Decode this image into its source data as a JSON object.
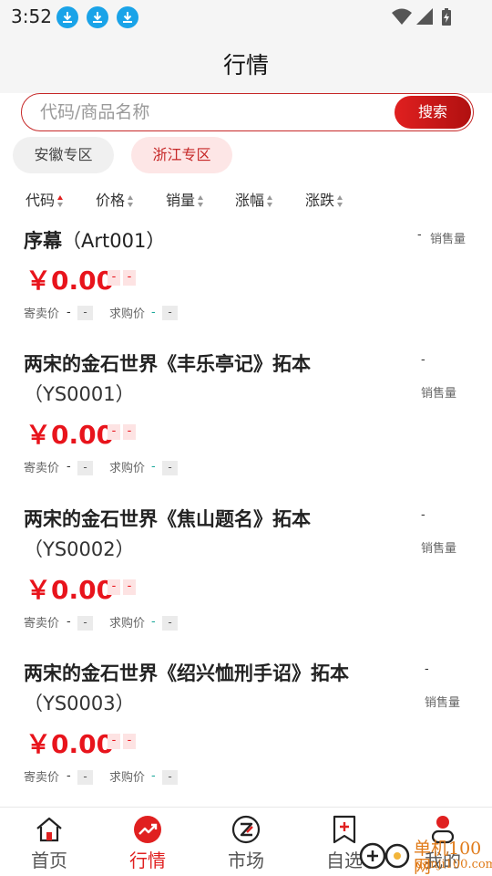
{
  "status_bar": {
    "time": "3:52"
  },
  "header": {
    "title": "行情"
  },
  "search": {
    "placeholder": "代码/商品名称",
    "button_label": "搜索"
  },
  "zones": [
    "安徽专区",
    "浙江专区"
  ],
  "zone_selected": "浙江专区",
  "sort_columns": [
    "代码",
    "价格",
    "销量",
    "涨幅",
    "涨跌"
  ],
  "items": [
    {
      "name": "序幕",
      "code": "（Art001）",
      "price": "￥0.00",
      "change": "-",
      "change_pct": "-",
      "sell_label": "寄卖价",
      "sell_value": "-",
      "sell_box": "-",
      "buy_label": "求购价",
      "buy_value": "-",
      "buy_box": "-",
      "volume": "-",
      "volume_label": "销售量"
    },
    {
      "name": "两宋的金石世界《丰乐亭记》拓本",
      "code": "（YS0001）",
      "price": "￥0.00",
      "change": "-",
      "change_pct": "-",
      "sell_label": "寄卖价",
      "sell_value": "-",
      "sell_box": "-",
      "buy_label": "求购价",
      "buy_value": "-",
      "buy_box": "-",
      "volume": "-",
      "volume_label": "销售量"
    },
    {
      "name": "两宋的金石世界《焦山题名》拓本",
      "code": "（YS0002）",
      "price": "￥0.00",
      "change": "-",
      "change_pct": "-",
      "sell_label": "寄卖价",
      "sell_value": "-",
      "sell_box": "-",
      "buy_label": "求购价",
      "buy_value": "-",
      "buy_box": "-",
      "volume": "-",
      "volume_label": "销售量"
    },
    {
      "name": "两宋的金石世界《绍兴恤刑手诏》拓本",
      "code": "（YS0003）",
      "price": "￥0.00",
      "change": "-",
      "change_pct": "-",
      "sell_label": "寄卖价",
      "sell_value": "-",
      "sell_box": "-",
      "buy_label": "求购价",
      "buy_value": "-",
      "buy_box": "-",
      "volume": "-",
      "volume_label": "销售量"
    }
  ],
  "bottom_nav": [
    {
      "label": "首页",
      "icon": "home-icon"
    },
    {
      "label": "行情",
      "icon": "trend-icon",
      "active": true
    },
    {
      "label": "市场",
      "icon": "market-icon"
    },
    {
      "label": "自选",
      "icon": "bookmark-icon"
    },
    {
      "label": "我的",
      "icon": "profile-icon"
    }
  ],
  "watermark": {
    "text": "单机100网",
    "sub": "danji100.com"
  },
  "colors": {
    "accent": "#e02020",
    "price": "#e8141c",
    "zone_selected_bg": "#fde6e6",
    "download_badge": "#1aa3e8",
    "watermark": "#e07b1a"
  }
}
